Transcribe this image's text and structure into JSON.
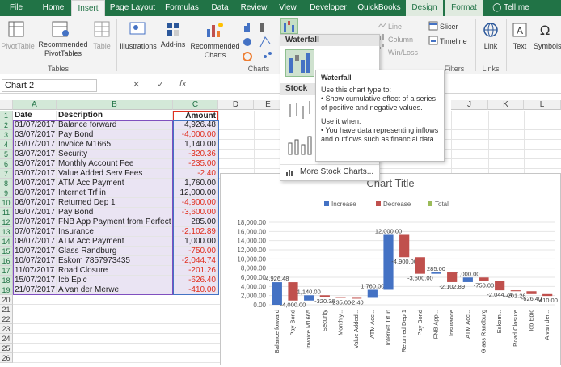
{
  "tabs": [
    "File",
    "Home",
    "Insert",
    "Page Layout",
    "Formulas",
    "Data",
    "Review",
    "View",
    "Developer",
    "QuickBooks",
    "Design",
    "Format"
  ],
  "tell_me": "Tell me",
  "ribbon": {
    "pivot_table": "PivotTable",
    "recommended_pivot": "Recommended PivotTables",
    "table": "Table",
    "tables_group": "Tables",
    "illustrations": "Illustrations",
    "addins": "Add-ins",
    "recommended_charts": "Recommended Charts",
    "charts_group": "Charts",
    "line": "Line",
    "column": "Column",
    "winloss": "Win/Loss",
    "slicer": "Slicer",
    "timeline": "Timeline",
    "filters_group": "Filters",
    "link": "Link",
    "links_group": "Links",
    "text": "Text",
    "symbols": "Symbols"
  },
  "name_box": "Chart 2",
  "fx_label": "fx",
  "columns": [
    "A",
    "B",
    "C",
    "D",
    "E",
    "F",
    "G",
    "H",
    "I",
    "J",
    "K",
    "L"
  ],
  "rows": [
    "1",
    "2",
    "3",
    "4",
    "5",
    "6",
    "7",
    "8",
    "9",
    "10",
    "11",
    "12",
    "13",
    "14",
    "15",
    "16",
    "17",
    "18",
    "19",
    "20",
    "21",
    "22",
    "23",
    "24",
    "25",
    "26"
  ],
  "table_headers": {
    "date": "Date",
    "description": "Description",
    "amount": "Amount"
  },
  "table_rows": [
    {
      "date": "01/07/2017",
      "desc": "Balance forward",
      "amount": "4,926.48",
      "neg": false
    },
    {
      "date": "03/07/2017",
      "desc": "Pay Bond",
      "amount": "-4,000.00",
      "neg": true
    },
    {
      "date": "03/07/2017",
      "desc": "Invoice M1665",
      "amount": "1,140.00",
      "neg": false
    },
    {
      "date": "03/07/2017",
      "desc": "Security",
      "amount": "-320.36",
      "neg": true
    },
    {
      "date": "03/07/2017",
      "desc": "Monthly Account Fee",
      "amount": "-235.00",
      "neg": true
    },
    {
      "date": "03/07/2017",
      "desc": "Value Added Serv Fees",
      "amount": "-2.40",
      "neg": true
    },
    {
      "date": "04/07/2017",
      "desc": "ATM Acc Payment",
      "amount": "1,760.00",
      "neg": false
    },
    {
      "date": "06/07/2017",
      "desc": "Internet Trf in",
      "amount": "12,000.00",
      "neg": false
    },
    {
      "date": "06/07/2017",
      "desc": "Returned Dep 1",
      "amount": "-4,900.00",
      "neg": true
    },
    {
      "date": "06/07/2017",
      "desc": "Pay Bond",
      "amount": "-3,600.00",
      "neg": true
    },
    {
      "date": "07/07/2017",
      "desc": "FNB App Payment from Perfect",
      "amount": "285.00",
      "neg": false
    },
    {
      "date": "07/07/2017",
      "desc": "Insurance",
      "amount": "-2,102.89",
      "neg": true
    },
    {
      "date": "08/07/2017",
      "desc": "ATM Acc Payment",
      "amount": "1,000.00",
      "neg": false
    },
    {
      "date": "10/07/2017",
      "desc": "Glass Randburg",
      "amount": "-750.00",
      "neg": true
    },
    {
      "date": "10/07/2017",
      "desc": "Eskom 7857973435",
      "amount": "-2,044.74",
      "neg": true
    },
    {
      "date": "11/07/2017",
      "desc": "Road Closure",
      "amount": "-201.26",
      "neg": true
    },
    {
      "date": "15/07/2017",
      "desc": "Icb Epic",
      "amount": "-626.40",
      "neg": true
    },
    {
      "date": "21/07/2017",
      "desc": "A van der Merwe",
      "amount": "-410.00",
      "neg": true
    }
  ],
  "menu": {
    "waterfall_head": "Waterfall",
    "stock_head": "Stock",
    "more_stock": "More Stock Charts..."
  },
  "tooltip": {
    "title": "Waterfall",
    "p1": "Use this chart type to:",
    "p2": "• Show cumulative effect of a series of positive and negative values.",
    "p3": "Use it when:",
    "p4": "• You have data representing inflows and outflows such as financial data."
  },
  "colors": {
    "increase": "#4472c4",
    "decrease": "#c0504d",
    "total": "#9bbb59",
    "excel_green": "#217346"
  },
  "chart_data": {
    "type": "bar",
    "title": "Chart Title",
    "legend": [
      "Increase",
      "Decrease",
      "Total"
    ],
    "legend_placement": "top",
    "ylim": [
      0,
      18000
    ],
    "yticks": [
      "0.00",
      "2,000.00",
      "4,000.00",
      "6,000.00",
      "8,000.00",
      "10,000.00",
      "12,000.00",
      "14,000.00",
      "16,000.00",
      "18,000.00"
    ],
    "categories": [
      "Balance forward",
      "Pay Bond",
      "Invoice M1665",
      "Security",
      "Monthly...",
      "Value Added...",
      "ATM Acc...",
      "Internet Trf in",
      "Returned Dep 1",
      "Pay Bond",
      "FNB App...",
      "Insurance",
      "ATM Acc...",
      "Glass Randburg",
      "Eskom...",
      "Road Closure",
      "Icb Epic",
      "A van der..."
    ],
    "values": [
      4926.48,
      -4000,
      1140,
      -320.36,
      -235,
      -2.4,
      1760,
      12000,
      -4900,
      -3600,
      285,
      -2102.89,
      1000,
      -750,
      -2044.74,
      -201.26,
      -626.4,
      -410
    ],
    "data_labels": [
      "4,926.48",
      "-4,000.00",
      "1,140.00",
      "-320.36",
      "-235.00",
      "-2.40",
      "1,760.00",
      "12,000.00",
      "-4,900.00",
      "-3,600.00",
      "285.00",
      "-2,102.89",
      "1,000.00",
      "-750.00",
      "-2,044.74",
      "-201.26",
      "-626.40",
      "-410.00"
    ]
  }
}
